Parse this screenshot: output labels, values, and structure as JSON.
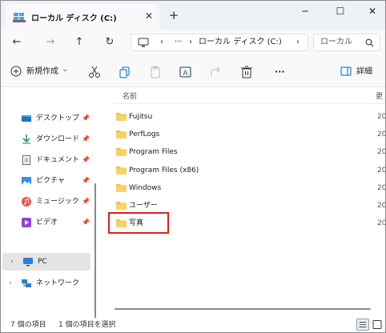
{
  "titlebar": {
    "tab_title": "ローカル ディスク (C:)",
    "close_tab_glyph": "✕",
    "new_tab_glyph": "+",
    "minimize_glyph": "─",
    "maximize_glyph": "☐",
    "close_glyph": "✕"
  },
  "addressbar": {
    "back_glyph": "←",
    "forward_glyph": "→",
    "up_glyph": "↑",
    "refresh_glyph": "↻",
    "sep1": "›",
    "overflow": "···",
    "sep2": "›",
    "location": "ローカル ディスク (C:)",
    "sep3": "›",
    "search_placeholder": "ローカル"
  },
  "commandbar": {
    "new_label": "新規作成",
    "new_chevron": "⌄",
    "more_glyph": "···",
    "details_label": "詳細"
  },
  "navpane": {
    "pinned": [
      {
        "label": "デスクトップ",
        "icon": "desktop-icon"
      },
      {
        "label": "ダウンロード",
        "icon": "download-icon"
      },
      {
        "label": "ドキュメント",
        "icon": "documents-icon"
      },
      {
        "label": "ピクチャ",
        "icon": "pictures-icon"
      },
      {
        "label": "ミュージック",
        "icon": "music-icon"
      },
      {
        "label": "ビデオ",
        "icon": "videos-icon"
      }
    ],
    "pin_glyph": "📌",
    "pc_label": "PC",
    "network_label": "ネットワーク",
    "chevron": "›"
  },
  "filelist": {
    "column_name": "名前",
    "column_date": "更",
    "items": [
      {
        "name": "Fujitsu",
        "date": "20"
      },
      {
        "name": "PerfLogs",
        "date": "20"
      },
      {
        "name": "Program Files",
        "date": "20"
      },
      {
        "name": "Program Files (x86)",
        "date": "20"
      },
      {
        "name": "Windows",
        "date": "20"
      },
      {
        "name": "ユーザー",
        "date": "20"
      },
      {
        "name": "写真",
        "date": "20"
      }
    ]
  },
  "statusbar": {
    "item_count": "7 個の項目",
    "selected": "1 個の項目を選択"
  },
  "colors": {
    "folder": "#f2c144",
    "highlight": "#d9211c",
    "accent": "#0067c0"
  }
}
